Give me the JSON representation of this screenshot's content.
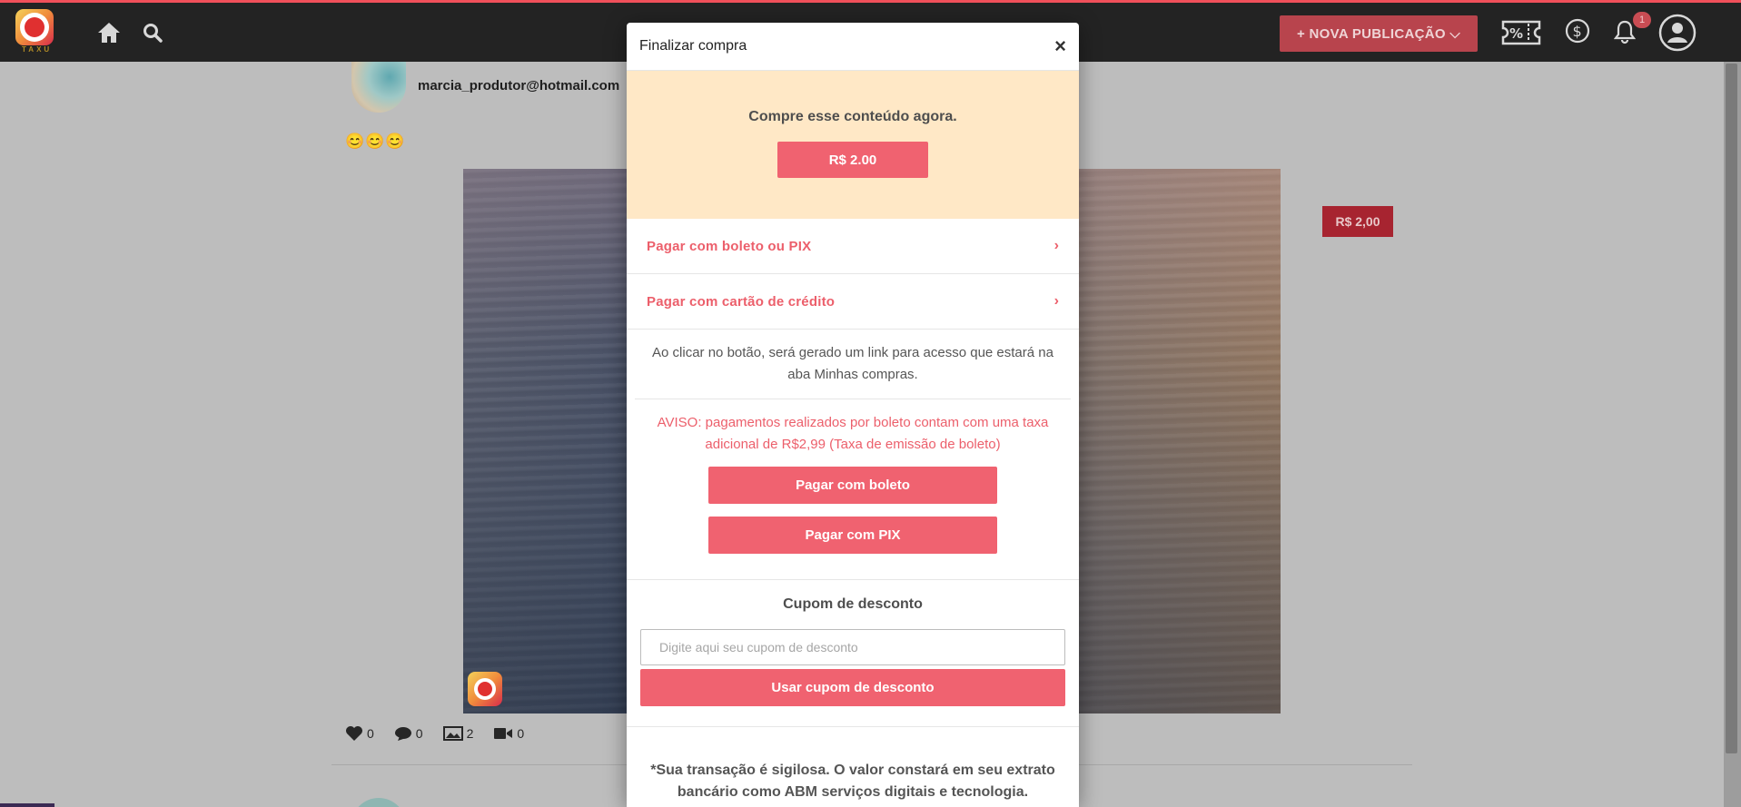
{
  "topbar": {
    "logo_text": "TAXU",
    "new_post_label": "+ NOVA PUBLICAÇÃO ⌵",
    "notification_count": "1",
    "accent_color": "#f0505a"
  },
  "feed": {
    "author": "marcia_produtor@hotmail.com",
    "emojis": "😊😊😊",
    "price_tag": "R$ 2,00",
    "stats": {
      "likes": "0",
      "comments": "0",
      "images": "2",
      "videos": "0"
    }
  },
  "modal": {
    "title": "Finalizar compra",
    "close_label": "×",
    "buy_text": "Compre esse conteúdo agora.",
    "price_button": "R$ 2.00",
    "options": [
      {
        "label": "Pagar com boleto ou PIX"
      },
      {
        "label": "Pagar com cartão de crédito"
      }
    ],
    "info_text": "Ao clicar no botão, será gerado um link para acesso que estará na aba Minhas compras.",
    "warning_text": "AVISO: pagamentos realizados por boleto contam com uma taxa adicional de R$2,99 (Taxa de emissão de boleto)",
    "boleto_button": "Pagar com boleto",
    "pix_button": "Pagar com PIX",
    "coupon_title": "Cupom de desconto",
    "coupon_placeholder": "Digite aqui seu cupom de desconto",
    "coupon_button": "Usar cupom de desconto",
    "footer_text": "*Sua transação é sigilosa. O valor constará em seu extrato bancário como ABM serviços digitais e tecnologia."
  },
  "icons": {
    "home": "home-icon",
    "search": "search-icon",
    "coupon": "coupon-icon",
    "dollar": "dollar-icon",
    "bell": "bell-icon",
    "user": "user-icon"
  },
  "colors": {
    "primary_button": "#f06270",
    "buy_box_bg": "#ffe8c6",
    "price_tag": "#a72430"
  }
}
